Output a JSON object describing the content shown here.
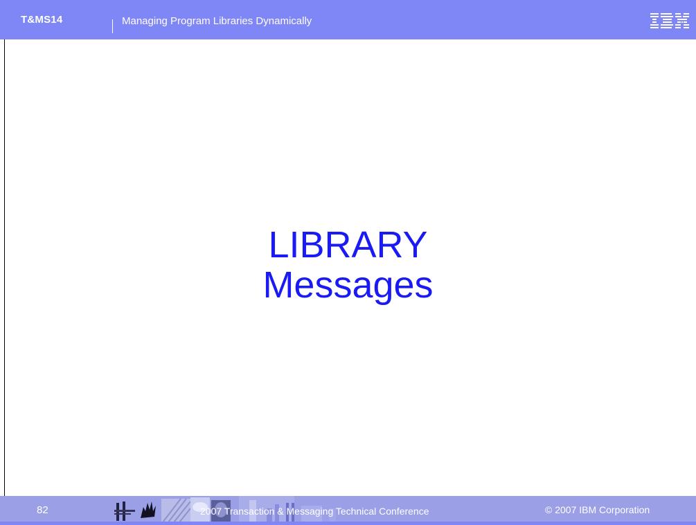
{
  "header": {
    "session_code": "T&MS14",
    "title": "Managing Program Libraries Dynamically",
    "logo_text": "IBM",
    "background_color": "#7f86f5"
  },
  "slide": {
    "title_line1": "LIBRARY",
    "title_line2": "Messages",
    "title_color": "#1a1af5"
  },
  "footer": {
    "page_number": "82",
    "conference": "2007 Transaction & Messaging Technical Conference",
    "copyright": "© 2007  IBM Corporation",
    "background_color": "#9a9fe6"
  }
}
